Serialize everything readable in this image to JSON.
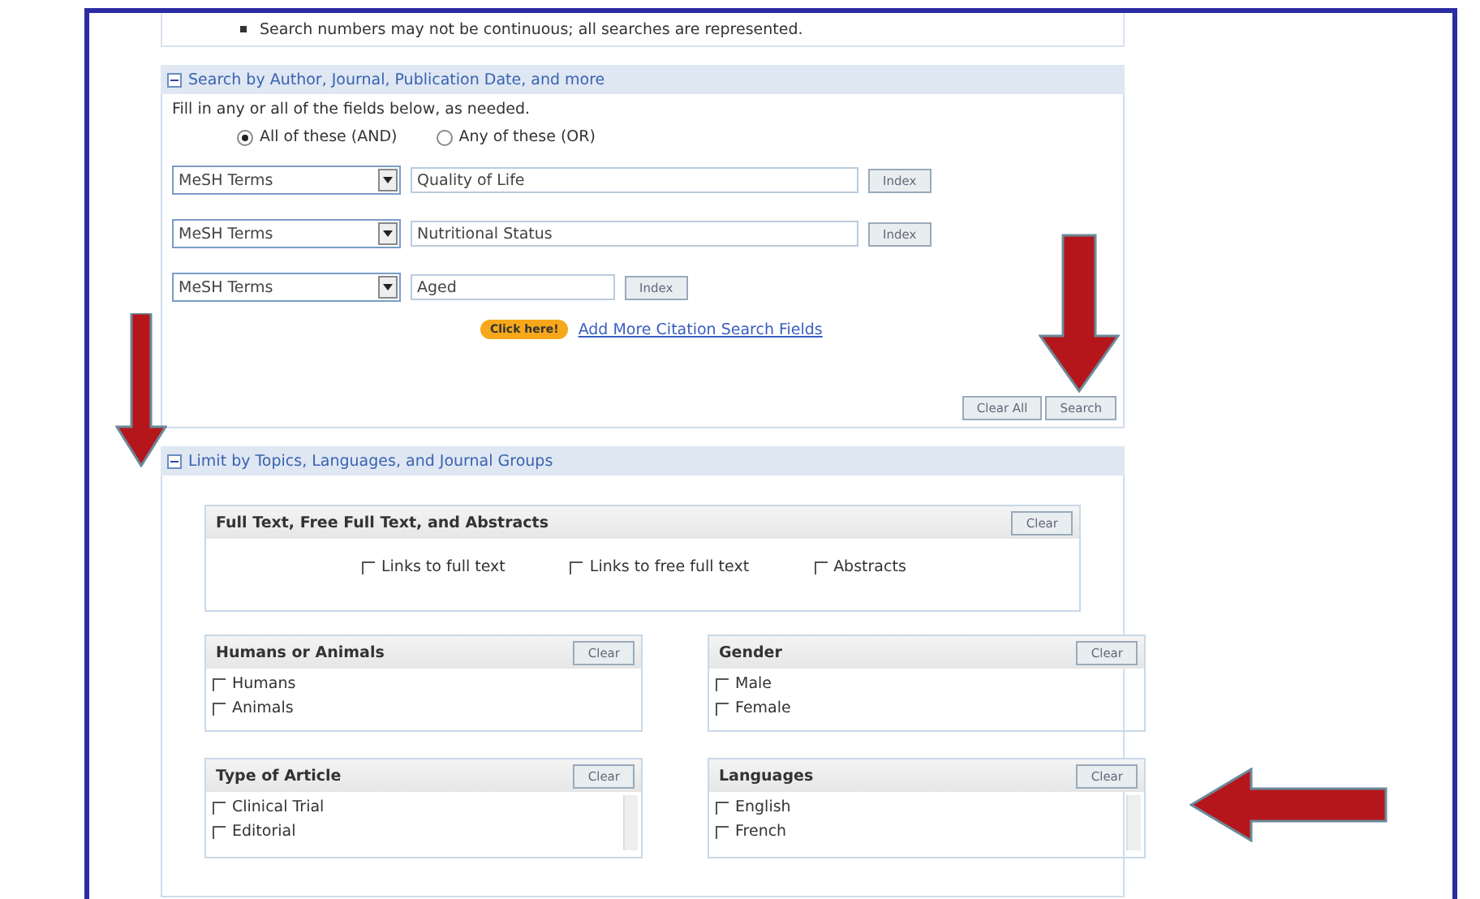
{
  "notice": "Search numbers may not be continuous; all searches are represented.",
  "citation_section": {
    "title": "Search by Author, Journal, Publication Date, and more",
    "expanded": true,
    "instructions": "Fill in any or all of the fields below, as needed.",
    "modes": [
      {
        "label": "All of these (AND)",
        "selected": true
      },
      {
        "label": "Any of these (OR)",
        "selected": false
      }
    ],
    "rows": [
      {
        "field": "MeSH Terms",
        "value": "Quality of Life",
        "index": "Index",
        "wide": true
      },
      {
        "field": "MeSH Terms",
        "value": "Nutritional Status",
        "index": "Index",
        "wide": true
      },
      {
        "field": "MeSH Terms",
        "value": "Aged",
        "index": "Index",
        "wide": false
      }
    ],
    "hint_badge": "Click here!",
    "add_link": "Add More Citation Search Fields",
    "buttons": [
      "Clear All",
      "Search"
    ]
  },
  "limits_section": {
    "title": "Limit by Topics, Languages, and Journal Groups",
    "expanded": true,
    "full_text": {
      "title": "Full Text, Free Full Text, and Abstracts",
      "clear": "Clear",
      "options": [
        {
          "label": "Links to full text",
          "checked": false
        },
        {
          "label": "Links to free full text",
          "checked": false
        },
        {
          "label": "Abstracts",
          "checked": false
        }
      ]
    },
    "groups": [
      {
        "title": "Humans or Animals",
        "clear": "Clear",
        "scroll": false,
        "options": [
          {
            "label": "Humans",
            "checked": false
          },
          {
            "label": "Animals",
            "checked": false
          }
        ]
      },
      {
        "title": "Gender",
        "clear": "Clear",
        "scroll": false,
        "options": [
          {
            "label": "Male",
            "checked": false
          },
          {
            "label": "Female",
            "checked": false
          }
        ]
      },
      {
        "title": "Type of Article",
        "clear": "Clear",
        "scroll": true,
        "options": [
          {
            "label": "Clinical Trial",
            "checked": false
          },
          {
            "label": "Editorial",
            "checked": false
          }
        ]
      },
      {
        "title": "Languages",
        "clear": "Clear",
        "scroll": true,
        "options": [
          {
            "label": "English",
            "checked": false
          },
          {
            "label": "French",
            "checked": false
          }
        ]
      }
    ]
  }
}
